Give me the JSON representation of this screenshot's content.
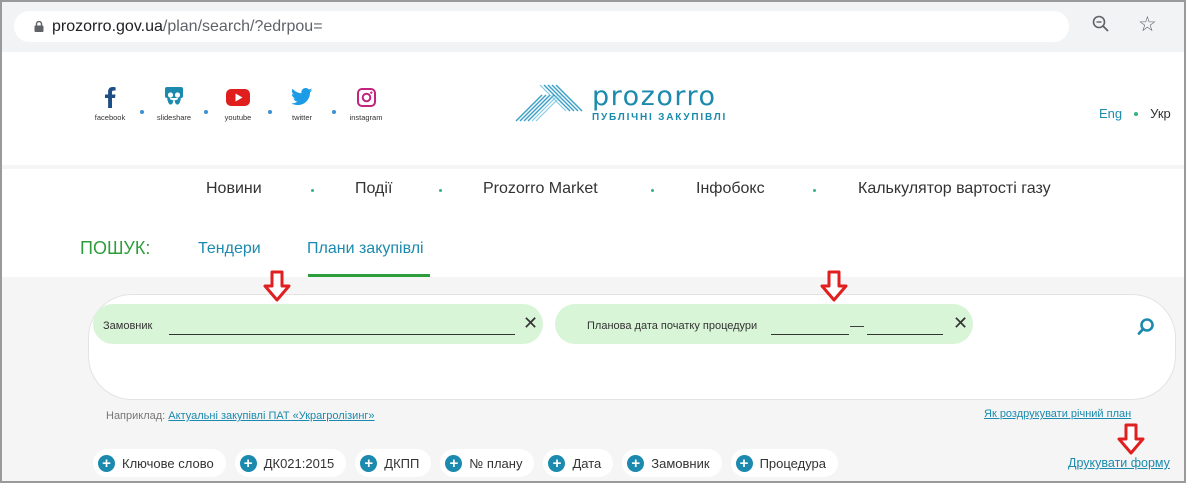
{
  "browser": {
    "url_host": "prozorro.gov.ua",
    "url_path": "/plan/search/?edrpou=",
    "icons": [
      "lock-icon",
      "zoom-icon",
      "star-icon"
    ]
  },
  "header": {
    "socials": [
      {
        "label": "facebook",
        "icon": "facebook-icon"
      },
      {
        "label": "slideshare",
        "icon": "slideshare-icon"
      },
      {
        "label": "youtube",
        "icon": "youtube-icon"
      },
      {
        "label": "twitter",
        "icon": "twitter-icon"
      },
      {
        "label": "instagram",
        "icon": "instagram-icon"
      }
    ],
    "logo_main": "prozorro",
    "logo_sub": "ПУБЛІЧНІ ЗАКУПІВЛІ",
    "lang_eng": "Eng",
    "lang_ukr": "Укр"
  },
  "nav": {
    "items": [
      "Новини",
      "Події",
      "Prozorro Market",
      "Інфобокс",
      "Калькулятор вартості газу"
    ]
  },
  "search": {
    "label": "ПОШУК:",
    "tabs": [
      "Тендери",
      "Плани закупівлі"
    ],
    "active_tab": "Плани закупівлі",
    "chip_customer": "Замовник",
    "chip_date": "Планова дата початку процедури",
    "chip_dash": "—",
    "close_glyph": "✕",
    "example_prefix": "Наприклад:",
    "example_link": "Актуальні закупівлі ПАТ «Украгролізинг»",
    "print_plan_link": "Як роздрукувати річний план",
    "filters": [
      "Ключове слово",
      "ДК021:2015",
      "ДКПП",
      "№ плану",
      "Дата",
      "Замовник",
      "Процедура"
    ],
    "print_form": "Друкувати форму"
  },
  "colors": {
    "accent_blue": "#1b8aae",
    "accent_green": "#2e9e3c",
    "chip_bg": "#d9f5d7",
    "annotation_red": "#e02020"
  }
}
